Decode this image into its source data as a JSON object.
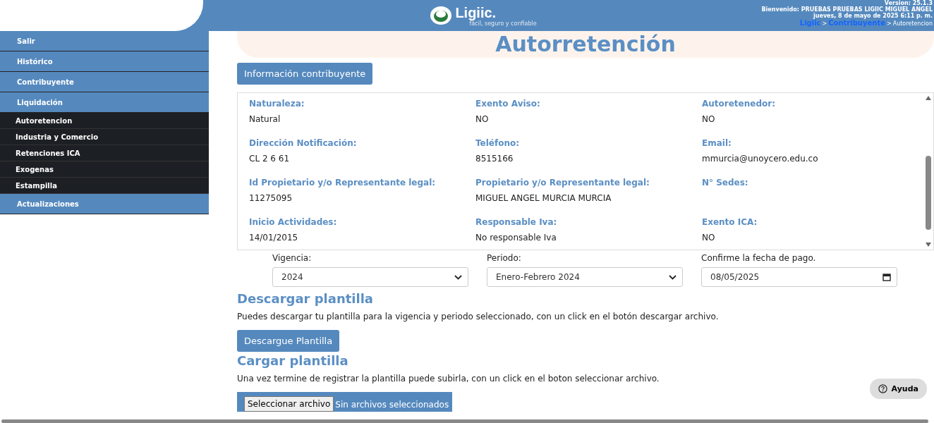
{
  "header": {
    "brand": "Ligiic.",
    "tagline": "fácil, seguro y confiable",
    "version": "Version: 25.1.3",
    "welcome": "Bienvenido: PRUEBAS PRUEBAS LIGIIC MIGUEL ANGEL",
    "date": "jueves, 8 de mayo de 2025 6:11 p. m.",
    "breadcrumb": [
      {
        "label": "Ligiic",
        "kind": "link"
      },
      {
        "label": ">",
        "kind": "separator"
      },
      {
        "label": "Contribuyente",
        "kind": "link"
      },
      {
        "label": ">",
        "kind": "separator"
      },
      {
        "label": "Autoretencion",
        "kind": "current"
      }
    ]
  },
  "sidebar": {
    "items": [
      {
        "label": "Salir"
      },
      {
        "label": "Histórico"
      },
      {
        "label": "Contribuyente"
      },
      {
        "label": "Liquidación",
        "children": [
          {
            "label": "Autoretencion"
          },
          {
            "label": "Industria y Comercio"
          },
          {
            "label": "Retenciones ICA"
          },
          {
            "label": "Exogenas"
          },
          {
            "label": "Estampilla"
          }
        ]
      },
      {
        "label": "Actualizaciones"
      }
    ]
  },
  "page_title": "Autorretención",
  "info_button": "Información contribuyente",
  "info_fields": [
    {
      "label": "Naturaleza:",
      "value": "Natural"
    },
    {
      "label": "Exento Aviso:",
      "value": "NO"
    },
    {
      "label": "Autoretenedor:",
      "value": "NO"
    },
    {
      "label": "Dirección Notificación:",
      "value": "CL 2 6 61"
    },
    {
      "label": "Teléfono:",
      "value": "8515166"
    },
    {
      "label": "Email:",
      "value": "mmurcia@unoycero.edu.co"
    },
    {
      "label": "Id Propietario y/o Representante legal:",
      "value": "11275095"
    },
    {
      "label": "Propietario y/o Representante legal:",
      "value": "MIGUEL ANGEL MURCIA MURCIA"
    },
    {
      "label": "N° Sedes:"
    },
    {
      "label": "Inicio Actividades:",
      "value": "14/01/2015"
    },
    {
      "label": "Responsable Iva:",
      "value": "No responsable Iva"
    },
    {
      "label": "Exento ICA:",
      "value": "NO"
    }
  ],
  "form_fields": [
    {
      "kind": "select",
      "label": "Vigencia:",
      "value": "2024"
    },
    {
      "kind": "select",
      "label": "Periodo:",
      "value": "Enero-Febrero 2024"
    },
    {
      "kind": "date",
      "label": "Confirme la fecha de pago.",
      "value": "08/05/2025"
    }
  ],
  "download": {
    "title": "Descargar plantilla",
    "text": "Puedes descargar tu plantilla para la vigencia y periodo seleccionado, con un click en el botón descargar archivo.",
    "button": "Descargue Plantilla"
  },
  "upload": {
    "title": "Cargar plantilla",
    "text": "Una vez termine de registrar la plantilla puede subirla, con un click en el boton seleccionar archivo.",
    "file_button": "Seleccionar archivo",
    "file_status": "Sin archivos seleccionados"
  },
  "help_button": "Ayuda"
}
